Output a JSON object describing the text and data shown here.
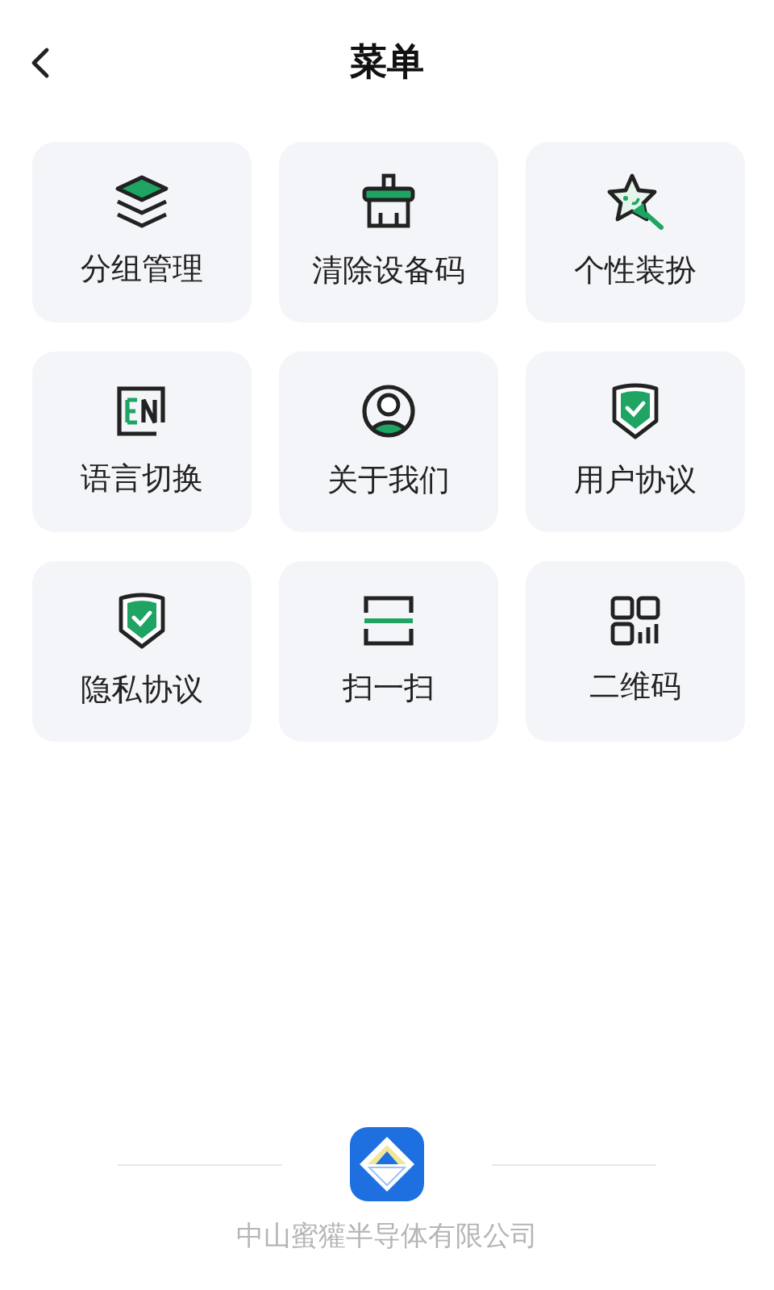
{
  "header": {
    "title": "菜单"
  },
  "menu": [
    {
      "kind": "layers",
      "label": "分组管理"
    },
    {
      "kind": "brush",
      "label": "清除设备码"
    },
    {
      "kind": "star",
      "label": "个性装扮"
    },
    {
      "kind": "language",
      "label": "语言切换"
    },
    {
      "kind": "person",
      "label": "关于我们"
    },
    {
      "kind": "shield",
      "label": "用户协议"
    },
    {
      "kind": "shield",
      "label": "隐私协议"
    },
    {
      "kind": "scan",
      "label": "扫一扫"
    },
    {
      "kind": "qr",
      "label": "二维码"
    }
  ],
  "footer": {
    "company": "中山蜜獾半导体有限公司"
  }
}
